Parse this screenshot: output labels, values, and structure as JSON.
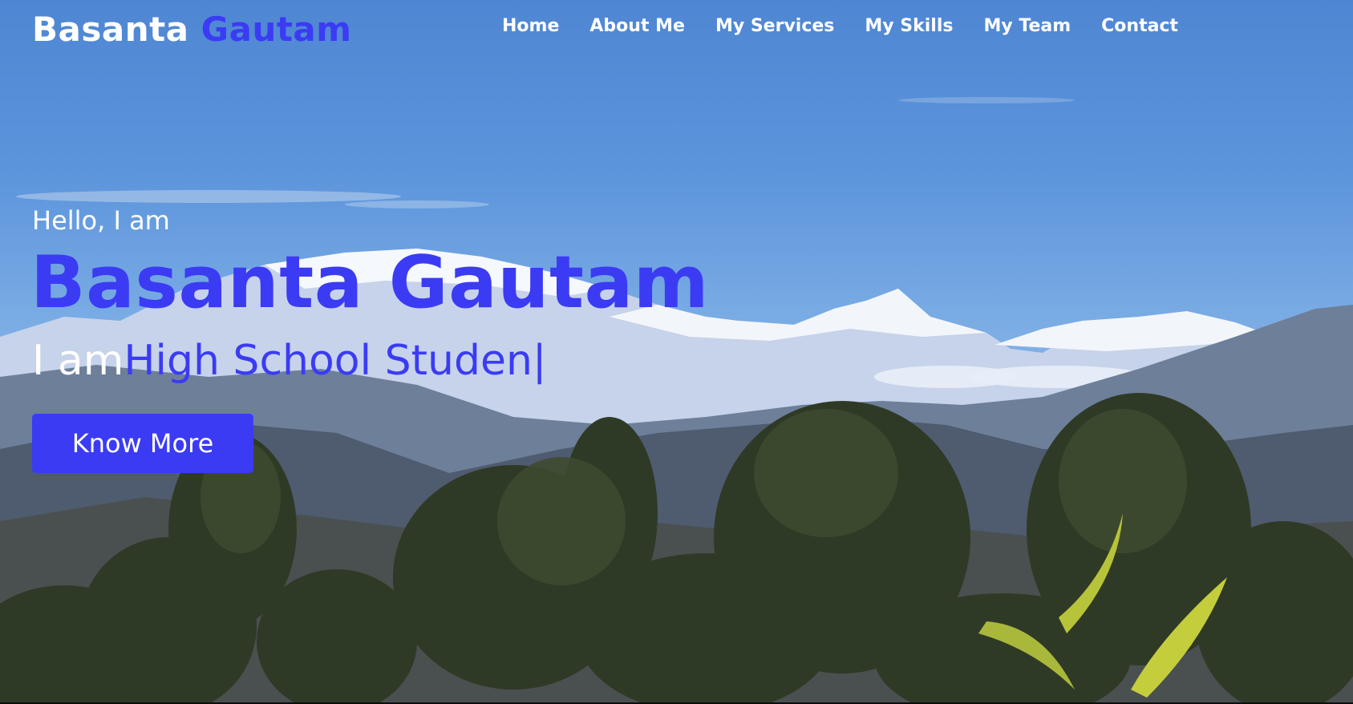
{
  "nav": {
    "brand_first": "Basanta",
    "brand_last": "Gautam",
    "links": [
      "Home",
      "About Me",
      "My Services",
      "My Skills",
      "My Team",
      "Contact"
    ]
  },
  "hero": {
    "greeting": "Hello, I am",
    "name": "Basanta Gautam",
    "role_prefix": "I am",
    "role_typed": "High School Studen",
    "cursor": "|",
    "cta_label": "Know More",
    "background": "mountain-landscape-photo"
  },
  "colors": {
    "accent": "#3b3bf4",
    "text": "#ffffff"
  }
}
